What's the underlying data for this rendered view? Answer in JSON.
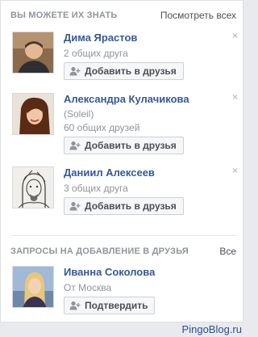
{
  "suggestions": {
    "title": "ВЫ МОЖЕТЕ ИХ ЗНАТЬ",
    "see_all": "Посмотреть всех",
    "people": [
      {
        "name": "Дима Ярастов",
        "line2": "2 общих друга",
        "button": "Добавить в друзья",
        "close": "×",
        "avatar_icon": "profile-photo-man"
      },
      {
        "name": "Александра Кулачикова",
        "line2": "(Soleil)",
        "line3": "60 общих друзей",
        "button": "Добавить в друзья",
        "close": "×",
        "avatar_icon": "profile-photo-woman"
      },
      {
        "name": "Даниил Алексеев",
        "line2": "3 общих друга",
        "button": "Добавить в друзья",
        "close": "×",
        "avatar_icon": "profile-sketch-portrait"
      }
    ]
  },
  "requests": {
    "title": "ЗАПРОСЫ НА ДОБАВЛЕНИЕ В ДРУЗЬЯ",
    "see_all": "Все",
    "people": [
      {
        "name": "Иванна Соколова",
        "line2": "От Москва",
        "button": "Подтвердить",
        "avatar_icon": "profile-photo-woman-blonde"
      }
    ]
  },
  "watermark": "PingoBlog.ru"
}
